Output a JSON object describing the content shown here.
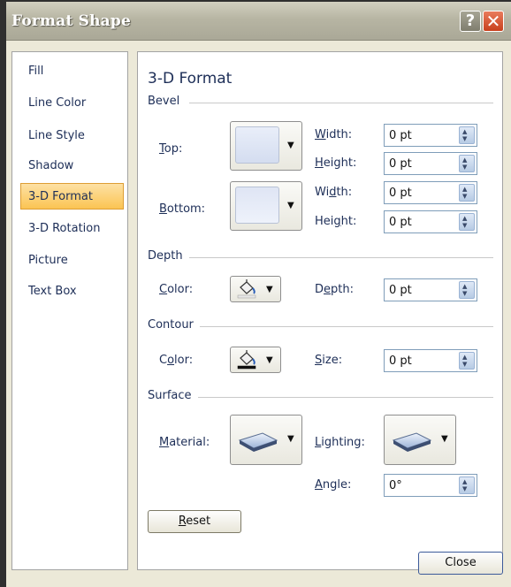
{
  "window": {
    "title": "Format Shape"
  },
  "titlebar": {
    "help": "?",
    "close": "✕"
  },
  "nav": [
    "Fill",
    "Line Color",
    "Line Style",
    "Shadow",
    "3-D Format",
    "3-D Rotation",
    "Picture",
    "Text Box"
  ],
  "panel": {
    "heading": "3-D Format",
    "bevel": {
      "section": "Bevel",
      "top_label": "Top:",
      "bottom_label": "Bottom:",
      "width_label": "Width:",
      "height_label": "Height:",
      "top_width": "0 pt",
      "top_height": "0 pt",
      "bottom_width": "0 pt",
      "bottom_height": "0 pt"
    },
    "depth": {
      "section": "Depth",
      "color_label": "Color:",
      "depth_label": "Depth:",
      "depth_value": "0 pt"
    },
    "contour": {
      "section": "Contour",
      "color_label": "Color:",
      "size_label": "Size:",
      "size_value": "0 pt"
    },
    "surface": {
      "section": "Surface",
      "material_label": "Material:",
      "lighting_label": "Lighting:",
      "angle_label": "Angle:",
      "angle_value": "0°"
    },
    "reset": "Reset"
  },
  "footer": {
    "close": "Close"
  },
  "colors": {
    "selected_nav": "#fbc453",
    "label_text": "#1d2e57"
  }
}
